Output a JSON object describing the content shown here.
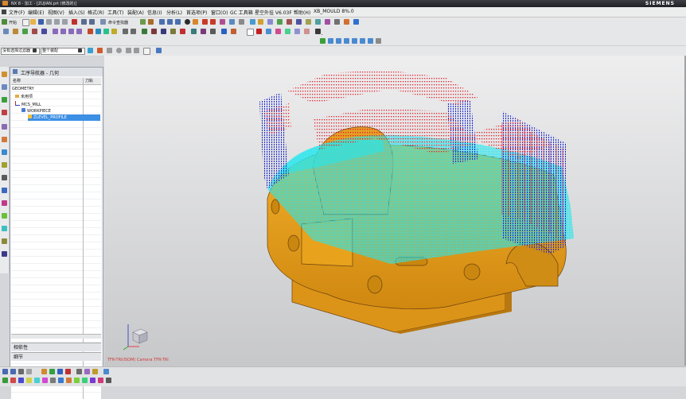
{
  "window": {
    "title": "NX 8 - 加工 - [ZUJIAN.prt (修改的)]",
    "brand": "SIEMENS"
  },
  "menu": [
    "文件(F)",
    "编辑(E)",
    "视图(V)",
    "插入(S)",
    "格式(R)",
    "工具(T)",
    "装配(A)",
    "信息(I)",
    "分析(L)",
    "首选项(P)",
    "窗口(O)",
    "GC 工具箱",
    "星空外挂 V6.03F",
    "帮助(H)",
    "XB_MOULD 8%.0"
  ],
  "toolbar2": {
    "selection_filter": "没有选择过滤器",
    "assembly_scope": "整个装配"
  },
  "toolbar1": {
    "start_label": "开始",
    "command_finder": "命令查找器"
  },
  "navigator": {
    "title": "工序导航器 - 几何",
    "columns": [
      "名称",
      "刀轨"
    ],
    "tree": [
      {
        "label": "GEOMETRY",
        "icon": "none"
      },
      {
        "label": "未用项",
        "icon": "folder-icon"
      },
      {
        "label": "MCS_MILL",
        "icon": "mcs-icon"
      },
      {
        "label": "WORKPIECE",
        "icon": "workpiece-icon"
      },
      {
        "label": "ZLEVEL_PROFILE",
        "icon": "operation-icon",
        "selected": true
      }
    ],
    "sections": [
      "相依性",
      "细节"
    ]
  },
  "viewport": {
    "view_label": "TFR-TRI(ISOM) Camera TFR-TRI"
  },
  "colors": {
    "part": "#e3a01a",
    "toolpath_red": "#e8202a",
    "toolpath_blue": "#2430d0",
    "toolpath_cyan": "#26e6ee",
    "selection": "#3d8fe4"
  }
}
